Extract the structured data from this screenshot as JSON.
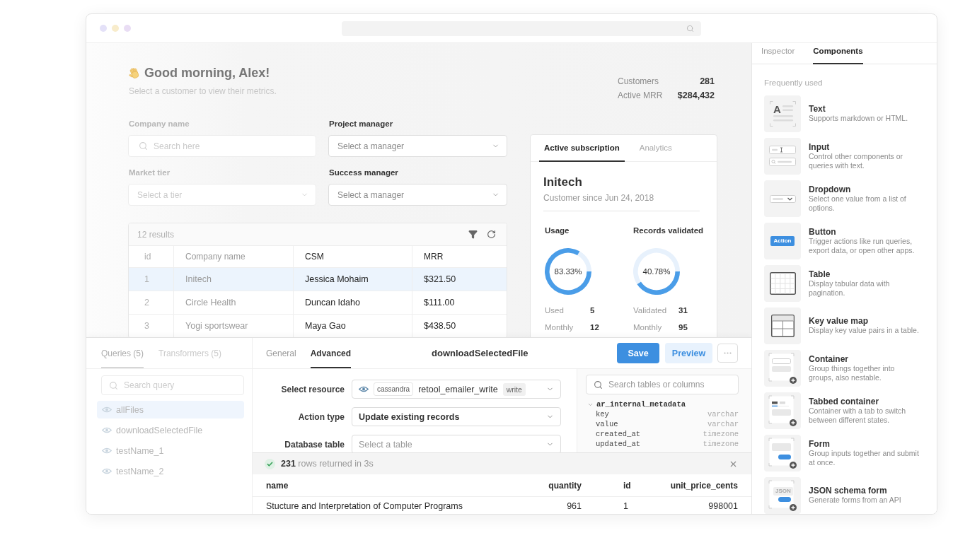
{
  "greeting": {
    "title": "Good morning, Alex!",
    "subtitle": "Select a customer to view their metrics."
  },
  "stats": [
    {
      "label": "Customers",
      "value": "281"
    },
    {
      "label": "Active MRR",
      "value": "$284,432"
    }
  ],
  "filters": [
    {
      "label": "Company name",
      "kind": "search",
      "placeholder": "Search here"
    },
    {
      "label": "Project manager",
      "kind": "select",
      "placeholder": "Select a manager"
    },
    {
      "label": "Market tier",
      "kind": "select",
      "placeholder": "Select a tier"
    },
    {
      "label": "Success manager",
      "kind": "select",
      "placeholder": "Select a manager"
    }
  ],
  "customers_table": {
    "count": "12 results",
    "columns": [
      "id",
      "Company name",
      "CSM",
      "MRR"
    ],
    "rows": [
      {
        "selected": true,
        "cells": [
          "1",
          "Initech",
          "Jessica Mohaim",
          "$321.50"
        ]
      },
      {
        "selected": false,
        "cells": [
          "2",
          "Circle Health",
          "Duncan Idaho",
          "$111.00"
        ]
      },
      {
        "selected": false,
        "cells": [
          "3",
          "Yogi sportswear",
          "Maya Gao",
          "$438.50"
        ]
      }
    ]
  },
  "subscription": {
    "tabs": [
      {
        "label": "Active subscription",
        "selected": true
      },
      {
        "label": "Analytics",
        "selected": false
      }
    ],
    "customer": "Initech",
    "since": "Customer since Jun 24, 2018",
    "metrics": [
      {
        "title": "Usage",
        "reading": "83.33%",
        "chart_data": {
          "type": "donut",
          "values": [
            83.33,
            16.67
          ]
        },
        "stats": [
          {
            "label": "Used",
            "value": "5"
          },
          {
            "label": "Monthly",
            "value": "12"
          }
        ]
      },
      {
        "title": "Records validated",
        "reading": "40.78%",
        "chart_data": {
          "type": "donut",
          "values": [
            40.78,
            59.22
          ]
        },
        "stats": [
          {
            "label": "Validated",
            "value": "31"
          },
          {
            "label": "Monthly",
            "value": "95"
          }
        ]
      }
    ]
  },
  "query_editor": {
    "sidebar_tabs": [
      {
        "label": "Queries (5)",
        "selected": true
      },
      {
        "label": "Transformers (5)",
        "selected": false
      }
    ],
    "search": {
      "placeholder": "Search query"
    },
    "queries": [
      {
        "name": "allFiles",
        "selected": true
      },
      {
        "name": "downloadSelectedFile",
        "selected": false
      },
      {
        "name": "testName_1",
        "selected": false
      },
      {
        "name": "testName_2",
        "selected": false
      }
    ],
    "tabs": [
      {
        "label": "General",
        "selected": false
      },
      {
        "label": "Advanced",
        "selected": true
      }
    ],
    "title": "downloadSelectedFile",
    "actions": [
      {
        "kind": "primary",
        "label": "Save"
      },
      {
        "kind": "secondary",
        "label": "Preview"
      },
      {
        "kind": "more"
      }
    ],
    "fields": [
      {
        "label": "Select resource",
        "kind": "resource",
        "resource_type": "cassandra",
        "value": "retool_emailer_write",
        "badge": "write"
      },
      {
        "label": "Action type",
        "kind": "select",
        "value": "Update existing records"
      },
      {
        "label": "Database table",
        "kind": "select",
        "placeholder": "Select a table"
      }
    ],
    "schema": {
      "search": {
        "placeholder": "Search tables or columns"
      },
      "tables": [
        {
          "name": "ar_internal_metadata",
          "expanded": true,
          "columns": [
            {
              "name": "key",
              "type": "varchar"
            },
            {
              "name": "value",
              "type": "varchar"
            },
            {
              "name": "created_at",
              "type": "timezone"
            },
            {
              "name": "updated_at",
              "type": "timezone"
            }
          ]
        }
      ]
    },
    "results": {
      "status": "**231** rows returned in 3s",
      "columns": [
        "name",
        "quantity",
        "id",
        "unit_price_cents"
      ],
      "rows": [
        [
          "Stucture and Interpretation of Computer Programs",
          "961",
          "1",
          "998001"
        ]
      ]
    }
  },
  "components_panel": {
    "tabs": [
      {
        "label": "Inspector",
        "selected": false
      },
      {
        "label": "Components",
        "selected": true
      }
    ],
    "section": "Frequently used",
    "components": [
      {
        "kind": "text",
        "icon_label": "A",
        "name": "Text",
        "description": "Supports markdown or HTML."
      },
      {
        "kind": "input",
        "name": "Input",
        "description": "Control other components or queries with text."
      },
      {
        "kind": "dropdown",
        "name": "Dropdown",
        "description": "Select one value from a list of options."
      },
      {
        "kind": "button",
        "icon_label": "Action",
        "name": "Button",
        "description": "Trigger actions like run queries, export data, or open other apps."
      },
      {
        "kind": "table",
        "name": "Table",
        "description": "Display tabular data with pagination."
      },
      {
        "kind": "key_value",
        "name": "Key value map",
        "description": "Display key value pairs in a table."
      },
      {
        "kind": "container",
        "name": "Container",
        "description": "Group things together into groups, also nestable."
      },
      {
        "kind": "tabbed_container",
        "name": "Tabbed container",
        "description": "Container with a tab to switch between different states."
      },
      {
        "kind": "form",
        "name": "Form",
        "description": "Group inputs together and submit at once."
      },
      {
        "kind": "json_form",
        "icon_label": "JSON",
        "name": "JSON schema form",
        "description": "Generate forms from an API"
      }
    ]
  }
}
